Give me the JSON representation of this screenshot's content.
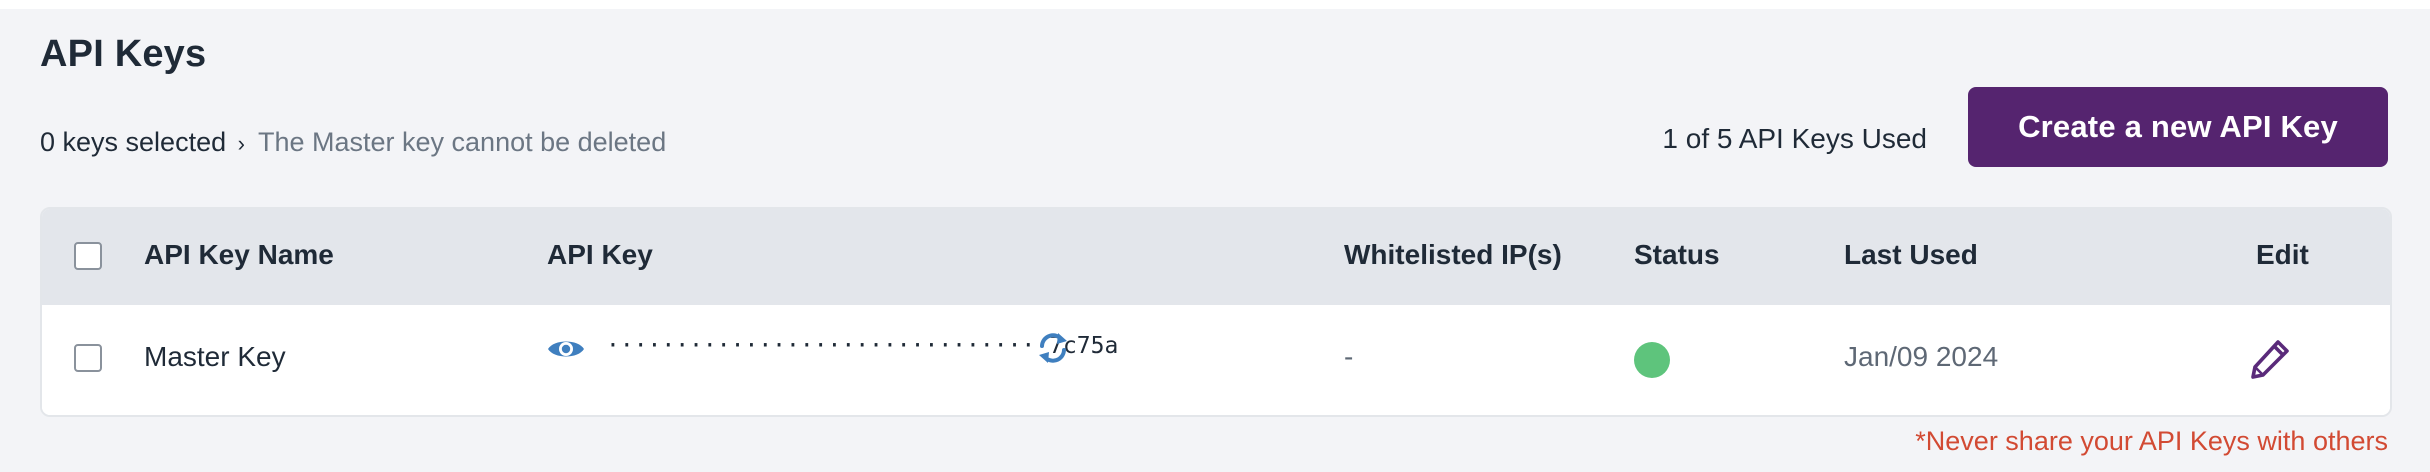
{
  "header": {
    "title": "API Keys",
    "selection_count": "0 keys selected",
    "separator": "›",
    "selection_note": "The Master key cannot be deleted",
    "usage": "1 of 5 API Keys Used",
    "create_button_label": "Create a new API Key"
  },
  "table": {
    "columns": {
      "name": "API Key Name",
      "key": "API Key",
      "whitelist": "Whitelisted IP(s)",
      "status": "Status",
      "last_used": "Last Used",
      "edit": "Edit"
    },
    "rows": [
      {
        "name": "Master Key",
        "masked_key": "································7c75a",
        "whitelisted_ips": "-",
        "status": "active",
        "status_color": "#5ec47c",
        "last_used": "Jan/09 2024",
        "icons": {
          "reveal": "eye-icon",
          "regenerate": "refresh-icon",
          "edit": "pencil-icon"
        }
      }
    ]
  },
  "footer": {
    "warning": "*Never share your API Keys with others"
  },
  "colors": {
    "brand": "#55246f",
    "icon_blue": "#3f7fbf",
    "edit_purple": "#5a2a7a",
    "warning": "#d24a33",
    "status_active": "#5ec47c"
  }
}
